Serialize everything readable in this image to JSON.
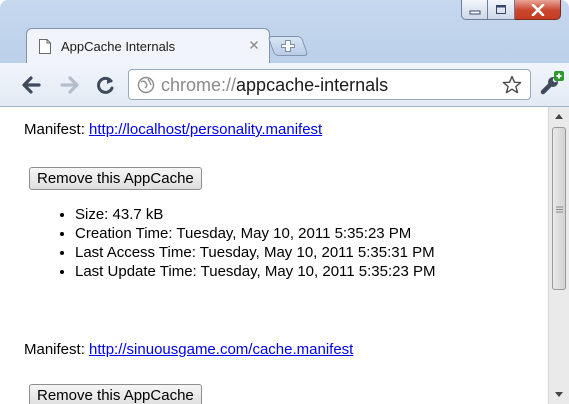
{
  "window": {
    "controls": {
      "minimize_icon": "minimize-icon",
      "maximize_icon": "maximize-icon",
      "close_icon": "close-icon"
    }
  },
  "tab": {
    "title": "AppCache Internals",
    "favicon": "page-icon",
    "close_label": "×"
  },
  "toolbar": {
    "url_scheme": "chrome://",
    "url_path": "appcache-internals"
  },
  "entries": [
    {
      "manifest_label": "Manifest:",
      "manifest_url": "http://localhost/personality.manifest",
      "remove_label": "Remove this AppCache",
      "details": [
        "Size: 43.7 kB",
        "Creation Time: Tuesday, May 10, 2011 5:35:23 PM",
        "Last Access Time: Tuesday, May 10, 2011 5:35:31 PM",
        "Last Update Time: Tuesday, May 10, 2011 5:35:23 PM"
      ]
    },
    {
      "manifest_label": "Manifest:",
      "manifest_url": "http://sinuousgame.com/cache.manifest",
      "remove_label": "Remove this AppCache"
    }
  ],
  "colors": {
    "link": "#0000ee",
    "close_button": "#c9452e",
    "wrench_badge": "#2e9a2e"
  }
}
